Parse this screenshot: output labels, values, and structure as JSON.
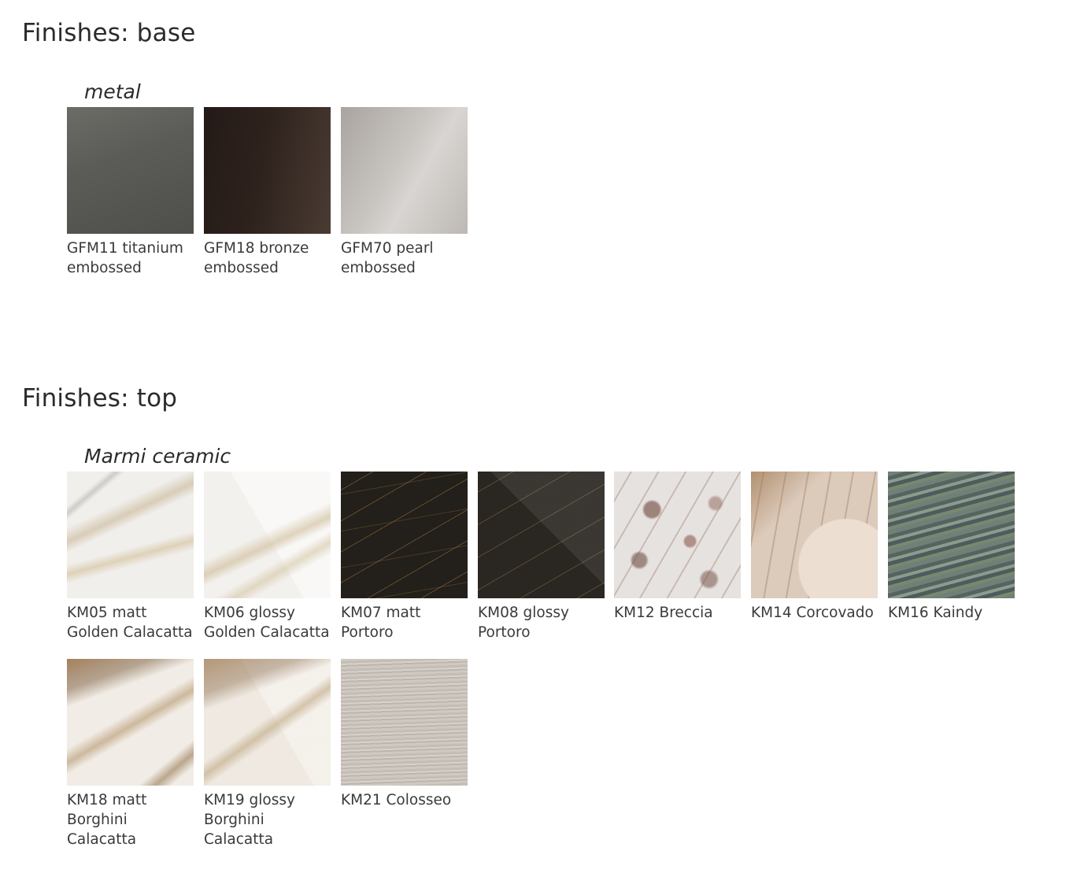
{
  "base": {
    "title": "Finishes: base",
    "group": "metal",
    "items": [
      {
        "code": "GFM11 titanium",
        "desc": "embossed",
        "desc2": ""
      },
      {
        "code": "GFM18 bronze",
        "desc": "embossed",
        "desc2": ""
      },
      {
        "code": "GFM70 pearl",
        "desc": "embossed",
        "desc2": ""
      }
    ]
  },
  "top": {
    "title": "Finishes: top",
    "group": "Marmi ceramic",
    "items": [
      {
        "code": "KM05 matt",
        "desc": "Golden Calacatta",
        "desc2": ""
      },
      {
        "code": "KM06 glossy",
        "desc": "Golden Calacatta",
        "desc2": ""
      },
      {
        "code": "KM07 matt",
        "desc": "Portoro",
        "desc2": ""
      },
      {
        "code": "KM08 glossy",
        "desc": "Portoro",
        "desc2": ""
      },
      {
        "code": "KM12 Breccia",
        "desc": "",
        "desc2": ""
      },
      {
        "code": "KM14 Corcovado",
        "desc": "",
        "desc2": ""
      },
      {
        "code": "KM16 Kaindy",
        "desc": "",
        "desc2": ""
      },
      {
        "code": "KM18 matt",
        "desc": "Borghini",
        "desc2": "Calacatta"
      },
      {
        "code": "KM19 glossy",
        "desc": "Borghini",
        "desc2": "Calacatta"
      },
      {
        "code": "KM21 Colosseo",
        "desc": "",
        "desc2": ""
      }
    ]
  }
}
